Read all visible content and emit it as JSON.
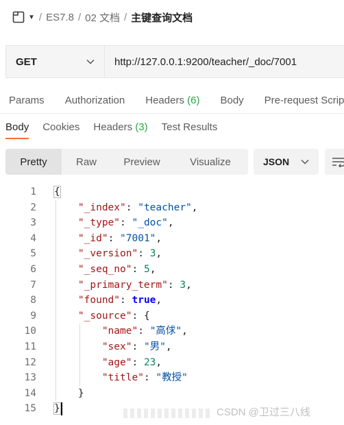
{
  "breadcrumb": {
    "items": [
      "ES7.8",
      "02 文档"
    ],
    "current": "主键查询文档",
    "separator": "/"
  },
  "request": {
    "method": "GET",
    "url": "http://127.0.0.1:9200/teacher/_doc/7001"
  },
  "request_tabs": [
    {
      "label": "Params"
    },
    {
      "label": "Authorization"
    },
    {
      "label": "Headers",
      "count": "(6)"
    },
    {
      "label": "Body"
    },
    {
      "label": "Pre-request Script"
    }
  ],
  "response_tabs": [
    {
      "label": "Body",
      "active": true
    },
    {
      "label": "Cookies"
    },
    {
      "label": "Headers",
      "count": "(3)"
    },
    {
      "label": "Test Results"
    }
  ],
  "view_modes": [
    "Pretty",
    "Raw",
    "Preview",
    "Visualize"
  ],
  "format": "JSON",
  "response_lines": [
    {
      "n": "1",
      "tokens": [
        {
          "t": "p",
          "v": "{"
        }
      ]
    },
    {
      "n": "2",
      "tokens": [
        {
          "t": "k",
          "v": "\"_index\""
        },
        {
          "t": "p",
          "v": ": "
        },
        {
          "t": "s",
          "v": "\"teacher\""
        },
        {
          "t": "p",
          "v": ","
        }
      ]
    },
    {
      "n": "3",
      "tokens": [
        {
          "t": "k",
          "v": "\"_type\""
        },
        {
          "t": "p",
          "v": ": "
        },
        {
          "t": "s",
          "v": "\"_doc\""
        },
        {
          "t": "p",
          "v": ","
        }
      ]
    },
    {
      "n": "4",
      "tokens": [
        {
          "t": "k",
          "v": "\"_id\""
        },
        {
          "t": "p",
          "v": ": "
        },
        {
          "t": "s",
          "v": "\"7001\""
        },
        {
          "t": "p",
          "v": ","
        }
      ]
    },
    {
      "n": "5",
      "tokens": [
        {
          "t": "k",
          "v": "\"_version\""
        },
        {
          "t": "p",
          "v": ": "
        },
        {
          "t": "n",
          "v": "3"
        },
        {
          "t": "p",
          "v": ","
        }
      ]
    },
    {
      "n": "6",
      "tokens": [
        {
          "t": "k",
          "v": "\"_seq_no\""
        },
        {
          "t": "p",
          "v": ": "
        },
        {
          "t": "n",
          "v": "5"
        },
        {
          "t": "p",
          "v": ","
        }
      ]
    },
    {
      "n": "7",
      "tokens": [
        {
          "t": "k",
          "v": "\"_primary_term\""
        },
        {
          "t": "p",
          "v": ": "
        },
        {
          "t": "n",
          "v": "3"
        },
        {
          "t": "p",
          "v": ","
        }
      ]
    },
    {
      "n": "8",
      "tokens": [
        {
          "t": "k",
          "v": "\"found\""
        },
        {
          "t": "p",
          "v": ": "
        },
        {
          "t": "b",
          "v": "true"
        },
        {
          "t": "p",
          "v": ","
        }
      ]
    },
    {
      "n": "9",
      "tokens": [
        {
          "t": "k",
          "v": "\"_source\""
        },
        {
          "t": "p",
          "v": ": {"
        }
      ]
    },
    {
      "n": "10",
      "tokens": [
        {
          "t": "k",
          "v": "\"name\""
        },
        {
          "t": "p",
          "v": ": "
        },
        {
          "t": "s",
          "v": "\"高俅\""
        },
        {
          "t": "p",
          "v": ","
        }
      ]
    },
    {
      "n": "11",
      "tokens": [
        {
          "t": "k",
          "v": "\"sex\""
        },
        {
          "t": "p",
          "v": ": "
        },
        {
          "t": "s",
          "v": "\"男\""
        },
        {
          "t": "p",
          "v": ","
        }
      ]
    },
    {
      "n": "12",
      "tokens": [
        {
          "t": "k",
          "v": "\"age\""
        },
        {
          "t": "p",
          "v": ": "
        },
        {
          "t": "n",
          "v": "23"
        },
        {
          "t": "p",
          "v": ","
        }
      ]
    },
    {
      "n": "13",
      "tokens": [
        {
          "t": "k",
          "v": "\"title\""
        },
        {
          "t": "p",
          "v": ": "
        },
        {
          "t": "s",
          "v": "\"教授\""
        }
      ]
    },
    {
      "n": "14",
      "tokens": [
        {
          "t": "p",
          "v": "}"
        }
      ]
    },
    {
      "n": "15",
      "tokens": [
        {
          "t": "p",
          "v": "}"
        }
      ]
    }
  ],
  "watermark": "CSDN @卫过三八线",
  "colors": {
    "accent": "#ff6c37",
    "count_green": "#29a745",
    "json_key": "#a31515",
    "json_string": "#0451a5",
    "json_number": "#098658",
    "json_boolean": "#0000ff"
  }
}
